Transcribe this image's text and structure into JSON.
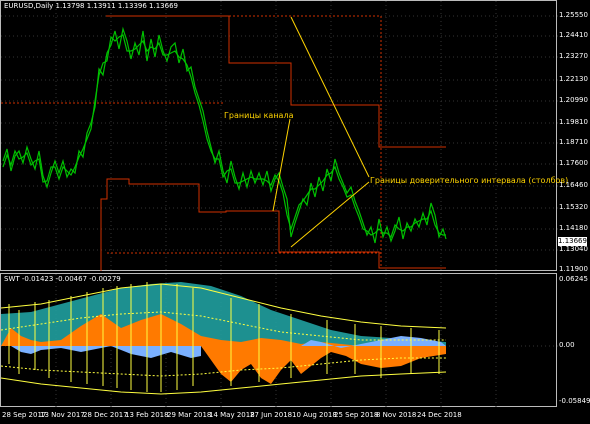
{
  "header": {
    "symbol_info": "EURUSD,Daily  1.13798 1.13911 1.13396 1.13669",
    "indicator_info": "SWT -0.01423 -0.00467 -0.00279"
  },
  "annotations": {
    "channel_label": "Границы канала",
    "confidence_label": "Границы доверительного интервала (столбов)"
  },
  "price_axis": {
    "ticks": [
      "1.25550",
      "1.24410",
      "1.23270",
      "1.22130",
      "1.20990",
      "1.19810",
      "1.18710",
      "1.17600",
      "1.16460",
      "1.15320",
      "1.14180",
      "1.13040",
      "1.11900"
    ],
    "current_price": "1.13669"
  },
  "sub_axis": {
    "ticks": [
      "0.06245",
      "0.00",
      "-0.05849"
    ]
  },
  "time_axis": {
    "ticks": [
      "28 Sep 2017",
      "13 Nov 2017",
      "28 Dec 2017",
      "13 Feb 2018",
      "29 Mar 2018",
      "14 May 2018",
      "27 Jun 2018",
      "10 Aug 2018",
      "25 Sep 2018",
      "8 Nov 2018",
      "24 Dec 2018"
    ]
  },
  "colors": {
    "candles": "#00c000",
    "channel": "#d03000",
    "annotation": "#ffd400",
    "teal_area": "#20a0a0",
    "orange_area": "#ff7a00",
    "blue_area": "#7ab0ff",
    "yellow_line": "#ffff40"
  }
}
